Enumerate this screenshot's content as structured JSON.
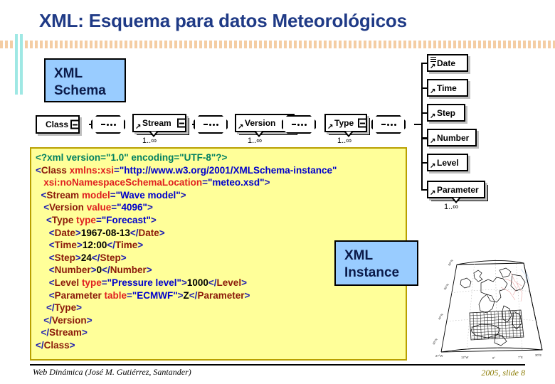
{
  "slide": {
    "title": "XML: Esquema para datos Meteorológicos",
    "footer_left": "Web Dinámica (José M. Gutiérrez, Santander)",
    "footer_right": "2005, slide 8"
  },
  "colors": {
    "title": "#1f3a86",
    "callout_bg": "#99ccff",
    "code_bg": "#ffff99",
    "code_border": "#b8a000",
    "stripe": "#f4cda4",
    "accent_bar": "#9fe8e4"
  },
  "callouts": {
    "schema": {
      "line1": "XML",
      "line2": "Schema"
    },
    "instance": {
      "line1": "XML",
      "line2": "Instance"
    }
  },
  "schema_diagram": {
    "chain": [
      {
        "label": "Class",
        "repeat": false,
        "mult": ""
      },
      {
        "label": "Stream",
        "repeat": true,
        "mult": "1..∞"
      },
      {
        "label": "Version",
        "repeat": true,
        "mult": "1..∞"
      },
      {
        "label": "Type",
        "repeat": true,
        "mult": "1..∞"
      }
    ],
    "sequence_icon": "sequence-connector-icon",
    "collapse_icon": "collapse-minus-icon",
    "children": [
      {
        "label": "Date",
        "repeat": false,
        "mult": "",
        "attributes": true
      },
      {
        "label": "Time",
        "repeat": false,
        "mult": "",
        "attributes": false
      },
      {
        "label": "Step",
        "repeat": false,
        "mult": "",
        "attributes": false
      },
      {
        "label": "Number",
        "repeat": false,
        "mult": "",
        "attributes": false
      },
      {
        "label": "Level",
        "repeat": false,
        "mult": "",
        "attributes": false
      },
      {
        "label": "Parameter",
        "repeat": true,
        "mult": "1..∞",
        "attributes": false
      }
    ]
  },
  "code": {
    "lines": [
      [
        {
          "t": "decl",
          "s": "<?xml version=\"1.0\" encoding=\"UTF-8\"?>"
        }
      ],
      [
        {
          "t": "pun",
          "s": "<"
        },
        {
          "t": "tag",
          "s": "Class "
        },
        {
          "t": "attr",
          "s": "xmlns:xsi"
        },
        {
          "t": "pun",
          "s": "="
        },
        {
          "t": "val",
          "s": "\"http://www.w3.org/2001/XMLSchema-instance\""
        }
      ],
      [
        {
          "t": "sp",
          "s": "   "
        },
        {
          "t": "attr",
          "s": "xsi:noNamespaceSchemaLocation"
        },
        {
          "t": "pun",
          "s": "="
        },
        {
          "t": "val",
          "s": "\"meteo.xsd\""
        },
        {
          "t": "pun",
          "s": ">"
        }
      ],
      [
        {
          "t": "sp",
          "s": "  "
        },
        {
          "t": "pun",
          "s": "<"
        },
        {
          "t": "tag",
          "s": "Stream "
        },
        {
          "t": "attr",
          "s": "model"
        },
        {
          "t": "pun",
          "s": "="
        },
        {
          "t": "val",
          "s": "\"Wave model\""
        },
        {
          "t": "pun",
          "s": ">"
        }
      ],
      [
        {
          "t": "sp",
          "s": "   "
        },
        {
          "t": "pun",
          "s": "<"
        },
        {
          "t": "tag",
          "s": "Version "
        },
        {
          "t": "attr",
          "s": "value"
        },
        {
          "t": "pun",
          "s": "="
        },
        {
          "t": "val",
          "s": "\"4096\""
        },
        {
          "t": "pun",
          "s": ">"
        }
      ],
      [
        {
          "t": "sp",
          "s": "    "
        },
        {
          "t": "pun",
          "s": "<"
        },
        {
          "t": "tag",
          "s": "Type "
        },
        {
          "t": "attr",
          "s": "type"
        },
        {
          "t": "pun",
          "s": "="
        },
        {
          "t": "val",
          "s": "\"Forecast\""
        },
        {
          "t": "pun",
          "s": ">"
        }
      ],
      [
        {
          "t": "sp",
          "s": "     "
        },
        {
          "t": "pun",
          "s": "<"
        },
        {
          "t": "tag",
          "s": "Date"
        },
        {
          "t": "pun",
          "s": ">"
        },
        {
          "t": "txt",
          "s": "1967-08-13"
        },
        {
          "t": "pun",
          "s": "</"
        },
        {
          "t": "tag",
          "s": "Date"
        },
        {
          "t": "pun",
          "s": ">"
        }
      ],
      [
        {
          "t": "sp",
          "s": "     "
        },
        {
          "t": "pun",
          "s": "<"
        },
        {
          "t": "tag",
          "s": "Time"
        },
        {
          "t": "pun",
          "s": ">"
        },
        {
          "t": "txt",
          "s": "12:00"
        },
        {
          "t": "pun",
          "s": "</"
        },
        {
          "t": "tag",
          "s": "Time"
        },
        {
          "t": "pun",
          "s": ">"
        }
      ],
      [
        {
          "t": "sp",
          "s": "     "
        },
        {
          "t": "pun",
          "s": "<"
        },
        {
          "t": "tag",
          "s": "Step"
        },
        {
          "t": "pun",
          "s": ">"
        },
        {
          "t": "txt",
          "s": "24"
        },
        {
          "t": "pun",
          "s": "</"
        },
        {
          "t": "tag",
          "s": "Step"
        },
        {
          "t": "pun",
          "s": ">"
        }
      ],
      [
        {
          "t": "sp",
          "s": "     "
        },
        {
          "t": "pun",
          "s": "<"
        },
        {
          "t": "tag",
          "s": "Number"
        },
        {
          "t": "pun",
          "s": ">"
        },
        {
          "t": "txt",
          "s": "0"
        },
        {
          "t": "pun",
          "s": "</"
        },
        {
          "t": "tag",
          "s": "Number"
        },
        {
          "t": "pun",
          "s": ">"
        }
      ],
      [
        {
          "t": "sp",
          "s": "     "
        },
        {
          "t": "pun",
          "s": "<"
        },
        {
          "t": "tag",
          "s": "Level "
        },
        {
          "t": "attr",
          "s": "type"
        },
        {
          "t": "pun",
          "s": "="
        },
        {
          "t": "val",
          "s": "\"Pressure level\""
        },
        {
          "t": "pun",
          "s": ">"
        },
        {
          "t": "txt",
          "s": "1000"
        },
        {
          "t": "pun",
          "s": "</"
        },
        {
          "t": "tag",
          "s": "Level"
        },
        {
          "t": "pun",
          "s": ">"
        }
      ],
      [
        {
          "t": "sp",
          "s": "     "
        },
        {
          "t": "pun",
          "s": "<"
        },
        {
          "t": "tag",
          "s": "Parameter "
        },
        {
          "t": "attr",
          "s": "table"
        },
        {
          "t": "pun",
          "s": "="
        },
        {
          "t": "val",
          "s": "\"ECMWF\""
        },
        {
          "t": "pun",
          "s": ">"
        },
        {
          "t": "txt",
          "s": "Z"
        },
        {
          "t": "pun",
          "s": "</"
        },
        {
          "t": "tag",
          "s": "Parameter"
        },
        {
          "t": "pun",
          "s": ">"
        }
      ],
      [
        {
          "t": "sp",
          "s": "    "
        },
        {
          "t": "pun",
          "s": "</"
        },
        {
          "t": "tag",
          "s": "Type"
        },
        {
          "t": "pun",
          "s": ">"
        }
      ],
      [
        {
          "t": "sp",
          "s": "   "
        },
        {
          "t": "pun",
          "s": "</"
        },
        {
          "t": "tag",
          "s": "Version"
        },
        {
          "t": "pun",
          "s": ">"
        }
      ],
      [
        {
          "t": "sp",
          "s": "  "
        },
        {
          "t": "pun",
          "s": "</"
        },
        {
          "t": "tag",
          "s": "Stream"
        },
        {
          "t": "pun",
          "s": ">"
        }
      ],
      [
        {
          "t": "pun",
          "s": "</"
        },
        {
          "t": "tag",
          "s": "Class"
        },
        {
          "t": "pun",
          "s": ">"
        }
      ]
    ]
  },
  "map": {
    "name": "europe-forecast-grid-map",
    "lat_labels": [
      "60°N",
      "50°N",
      "40°N",
      "30°N"
    ],
    "lon_labels": [
      "27°W",
      "12°W",
      "0°",
      "7°E",
      "30°E"
    ]
  }
}
